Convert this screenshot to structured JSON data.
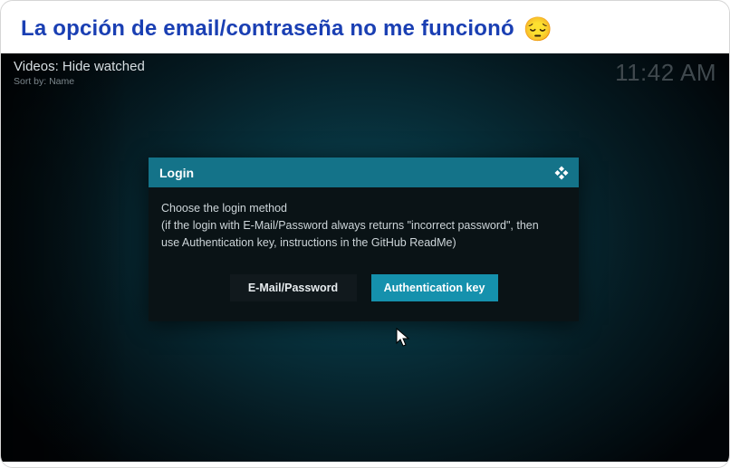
{
  "caption": {
    "text": "La opción de email/contraseña no me funcionó",
    "emoji": "😔"
  },
  "topbar": {
    "title": "Videos: Hide watched",
    "sort": "Sort by: Name",
    "clock": "11:42 AM"
  },
  "dialog": {
    "title": "Login",
    "message": "Choose the login method\n(if the login with E-Mail/Password always returns \"incorrect password\", then use Authentication key, instructions in the GitHub ReadMe)",
    "buttons": {
      "email": "E-Mail/Password",
      "authkey": "Authentication key"
    }
  },
  "icons": {
    "kodi": "kodi-logo"
  }
}
